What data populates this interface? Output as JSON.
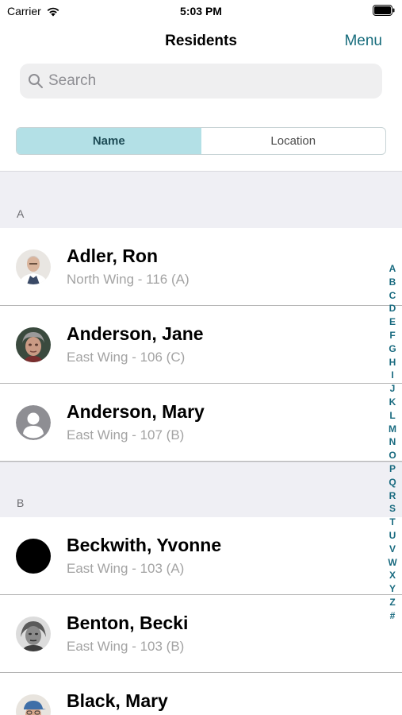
{
  "status_bar": {
    "carrier": "Carrier",
    "time": "5:03 PM"
  },
  "nav": {
    "title": "Residents",
    "menu_label": "Menu"
  },
  "search": {
    "placeholder": "Search"
  },
  "segments": [
    {
      "label": "Name",
      "selected": true
    },
    {
      "label": "Location",
      "selected": false
    }
  ],
  "sections": [
    {
      "letter": "A",
      "residents": [
        {
          "name": "Adler, Ron",
          "location": "North Wing - 116 (A)",
          "avatar": "photo-elderly-man-icon"
        },
        {
          "name": "Anderson, Jane",
          "location": "East Wing - 106 (C)",
          "avatar": "photo-elderly-woman-icon"
        },
        {
          "name": "Anderson, Mary",
          "location": "East Wing - 107 (B)",
          "avatar": "placeholder-person-icon"
        }
      ]
    },
    {
      "letter": "B",
      "residents": [
        {
          "name": "Beckwith, Yvonne",
          "location": "East Wing - 103 (A)",
          "avatar": "black-circle-icon"
        },
        {
          "name": "Benton, Becki",
          "location": "East Wing - 103 (B)",
          "avatar": "photo-elderly-woman-icon"
        },
        {
          "name": "Black, Mary",
          "location": "",
          "avatar": "photo-person-cap-icon"
        }
      ]
    }
  ],
  "index_letters": [
    "A",
    "B",
    "C",
    "D",
    "E",
    "F",
    "G",
    "H",
    "I",
    "J",
    "K",
    "L",
    "M",
    "N",
    "O",
    "P",
    "Q",
    "R",
    "S",
    "T",
    "U",
    "V",
    "W",
    "X",
    "Y",
    "Z",
    "#"
  ],
  "colors": {
    "accent": "#176c7c",
    "segment_selected": "#b3e0e6",
    "section_bg": "#efeff4",
    "secondary_text": "#a3a3a3"
  }
}
